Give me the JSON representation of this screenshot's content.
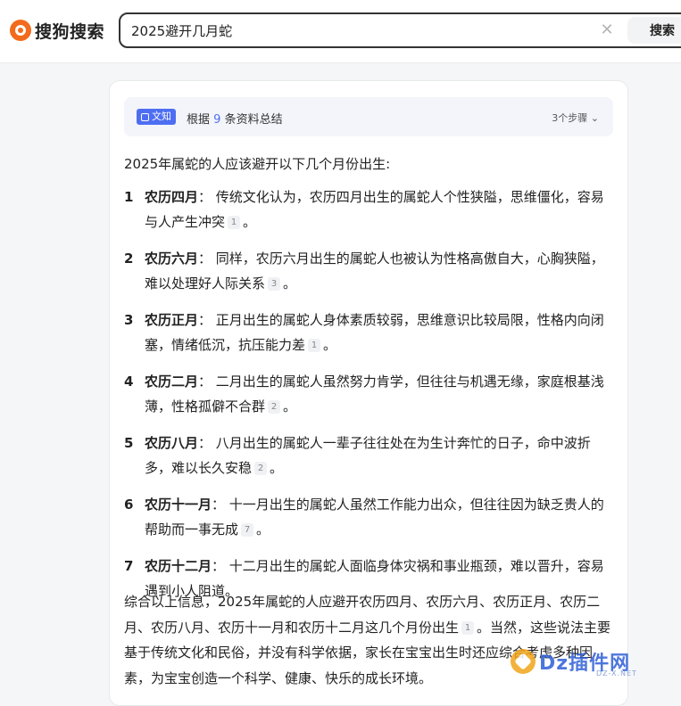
{
  "header": {
    "logo_text": "搜狗搜索",
    "search_value": "2025避开几月蛇",
    "search_button": "搜索"
  },
  "summary": {
    "badge": "文知",
    "prefix": "根据",
    "count": "9",
    "suffix": "条资料总结",
    "steps": "3个步骤"
  },
  "content": {
    "intro": "2025年属蛇的人应该避开以下几个月份出生:",
    "items": [
      {
        "num": "1",
        "title": "农历四月",
        "text": "传统文化认为，农历四月出生的属蛇人个性狭隘，思维僵化，容易与人产生冲突",
        "cite": "1",
        "end": "。"
      },
      {
        "num": "2",
        "title": "农历六月",
        "text": "同样，农历六月出生的属蛇人也被认为性格高傲自大，心胸狭隘，难以处理好人际关系",
        "cite": "3",
        "end": "。"
      },
      {
        "num": "3",
        "title": "农历正月",
        "text": "正月出生的属蛇人身体素质较弱，思维意识比较局限，性格内向闭塞，情绪低沉，抗压能力差",
        "cite": "1",
        "end": "。"
      },
      {
        "num": "4",
        "title": "农历二月",
        "text": "二月出生的属蛇人虽然努力肯学，但往往与机遇无缘，家庭根基浅薄，性格孤僻不合群",
        "cite": "2",
        "end": "。"
      },
      {
        "num": "5",
        "title": "农历八月",
        "text": "八月出生的属蛇人一辈子往往处在为生计奔忙的日子，命中波折多，难以长久安稳",
        "cite": "2",
        "end": "。"
      },
      {
        "num": "6",
        "title": "农历十一月",
        "text": "十一月出生的属蛇人虽然工作能力出众，但往往因为缺乏贵人的帮助而一事无成",
        "cite": "7",
        "end": "。"
      },
      {
        "num": "7",
        "title": "农历十二月",
        "text": "十二月出生的属蛇人面临身体灾祸和事业瓶颈，难以晋升，容易遇到小人阻道。",
        "cite": "",
        "end": ""
      }
    ],
    "conclusion_a": "综合以上信息，2025年属蛇的人应避开农历四月、农历六月、农历正月、农历二月、农历八月、农历十一月和农历十二月这几个月份出生",
    "conclusion_cite": "1",
    "conclusion_b": "。当然，这些说法主要基于传统文化和民俗，并没有科学依据，家长在宝宝出生时还应综合考虑多种因素，为宝宝创造一个科学、健康、快乐的成长环境。"
  },
  "watermark": {
    "text": "Dz插件网",
    "sub": "DZ-X.NET"
  }
}
